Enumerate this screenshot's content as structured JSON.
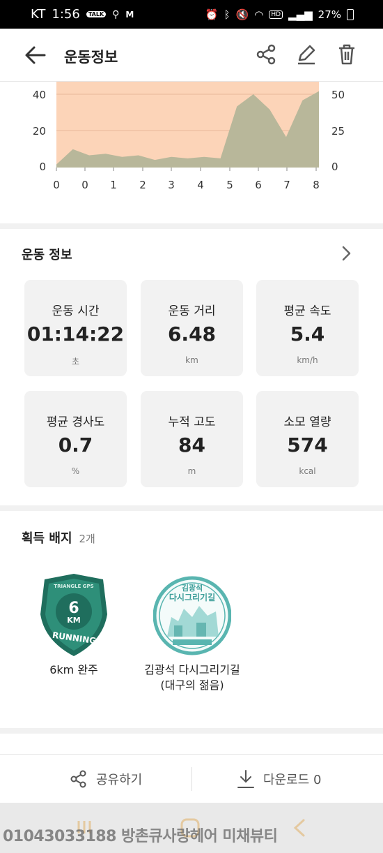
{
  "status_bar": {
    "carrier": "KT",
    "time": "1:56",
    "talk_label": "TALK",
    "m_label": "M",
    "wifi_label": "HD",
    "battery": "27%"
  },
  "header": {
    "title": "운동정보"
  },
  "elevation_chart": {
    "left_ticks": [
      "40",
      "20",
      "0"
    ],
    "right_ticks": [
      "50",
      "25",
      "0"
    ],
    "x_ticks": [
      "0",
      "0",
      "1",
      "2",
      "3",
      "4",
      "5",
      "6",
      "7",
      "8"
    ]
  },
  "chart_data": {
    "type": "area",
    "x": [
      0,
      0.5,
      1,
      1.5,
      2,
      2.5,
      3,
      3.5,
      4,
      4.5,
      5,
      5.5,
      6,
      6.5,
      7,
      7.5,
      8
    ],
    "series": [
      {
        "values": [
          2,
          12,
          8,
          9,
          7,
          8,
          5,
          7,
          6,
          7,
          6,
          40,
          48,
          38,
          20,
          44,
          50
        ]
      }
    ],
    "left_axis_ticks": [
      0,
      20,
      40
    ],
    "right_axis_ticks": [
      0,
      25,
      50
    ],
    "xlim": [
      0,
      8
    ],
    "colors": {
      "background": "#fcd4b8",
      "area": "#b8b79a"
    },
    "grid": true
  },
  "stats_section": {
    "title": "운동 정보",
    "cards": [
      {
        "label": "운동 시간",
        "value": "01:14:22",
        "unit": "초"
      },
      {
        "label": "운동 거리",
        "value": "6.48",
        "unit": "km"
      },
      {
        "label": "평균 속도",
        "value": "5.4",
        "unit": "km/h"
      },
      {
        "label": "평균 경사도",
        "value": "0.7",
        "unit": "%"
      },
      {
        "label": "누적 고도",
        "value": "84",
        "unit": "m"
      },
      {
        "label": "소모 열량",
        "value": "574",
        "unit": "kcal"
      }
    ]
  },
  "badges_section": {
    "title": "획득 배지",
    "count": "2개",
    "badges": [
      {
        "name": "6km 완주",
        "shield_top": "TRIANGLE GPS",
        "shield_num": "6",
        "shield_km": "KM",
        "shield_text": "RUNNING"
      },
      {
        "name_line1": "김광석 다시그리기길",
        "name_line2": "(대구의 젊음)",
        "stamp_line1": "김광석",
        "stamp_line2": "다시그리기길"
      }
    ]
  },
  "bottom_actions": {
    "share": "공유하기",
    "download": "다운로드 0"
  },
  "overlay": {
    "text": "01043033188 방촌큐사랑헤어 미채뷰티"
  },
  "colors": {
    "accent_teal": "#2e8f79",
    "chart_bg": "#fcd4b8",
    "chart_area": "#b8b79a"
  }
}
